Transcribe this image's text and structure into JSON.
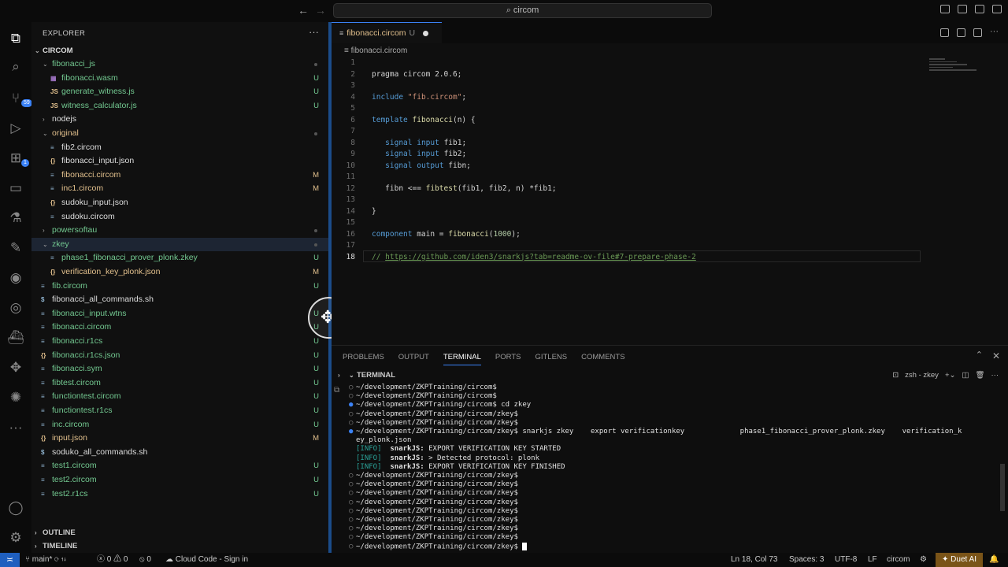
{
  "titlebar": {
    "search": "circom",
    "back_icon": "arrow-left-icon",
    "forward_icon": "arrow-right-icon"
  },
  "activitybar": {
    "source_control_badge": "59",
    "extensions_badge": "1"
  },
  "sidebar": {
    "title": "EXPLORER",
    "more": "···",
    "folder": "CIRCOM",
    "items": [
      {
        "name": "fibonacci_js",
        "kind": "folder",
        "open": true,
        "depth": 1,
        "color": "green",
        "status": "dot"
      },
      {
        "name": "fibonacci.wasm",
        "kind": "file",
        "icon": "▦",
        "depth": 2,
        "color": "green",
        "status": "U"
      },
      {
        "name": "generate_witness.js",
        "kind": "file",
        "icon": "JS",
        "depth": 2,
        "color": "green",
        "status": "U"
      },
      {
        "name": "witness_calculator.js",
        "kind": "file",
        "icon": "JS",
        "depth": 2,
        "color": "green",
        "status": "U"
      },
      {
        "name": "nodejs",
        "kind": "folder",
        "open": false,
        "depth": 1,
        "color": "white",
        "status": ""
      },
      {
        "name": "original",
        "kind": "folder",
        "open": true,
        "depth": 1,
        "color": "yellow",
        "status": "dot"
      },
      {
        "name": "fib2.circom",
        "kind": "file",
        "icon": "≡",
        "depth": 2,
        "color": "white",
        "status": ""
      },
      {
        "name": "fibonacci_input.json",
        "kind": "file",
        "icon": "{}",
        "depth": 2,
        "color": "white",
        "status": ""
      },
      {
        "name": "fibonacci.circom",
        "kind": "file",
        "icon": "≡",
        "depth": 2,
        "color": "yellow",
        "status": "M"
      },
      {
        "name": "inc1.circom",
        "kind": "file",
        "icon": "≡",
        "depth": 2,
        "color": "yellow",
        "status": "M"
      },
      {
        "name": "sudoku_input.json",
        "kind": "file",
        "icon": "{}",
        "depth": 2,
        "color": "white",
        "status": ""
      },
      {
        "name": "sudoku.circom",
        "kind": "file",
        "icon": "≡",
        "depth": 2,
        "color": "white",
        "status": ""
      },
      {
        "name": "powersoftau",
        "kind": "folder",
        "open": false,
        "depth": 1,
        "color": "green",
        "status": "dot"
      },
      {
        "name": "zkey",
        "kind": "folder",
        "open": true,
        "depth": 1,
        "color": "green",
        "status": "dot",
        "selected": true
      },
      {
        "name": "phase1_fibonacci_prover_plonk.zkey",
        "kind": "file",
        "icon": "≡",
        "depth": 2,
        "color": "green",
        "status": "U"
      },
      {
        "name": "verification_key_plonk.json",
        "kind": "file",
        "icon": "{}",
        "depth": 2,
        "color": "yellow",
        "status": "M"
      },
      {
        "name": "fib.circom",
        "kind": "file",
        "icon": "≡",
        "depth": 1,
        "color": "green",
        "status": "U"
      },
      {
        "name": "fibonacci_all_commands.sh",
        "kind": "file",
        "icon": "$",
        "depth": 1,
        "color": "white",
        "status": ""
      },
      {
        "name": "fibonacci_input.wtns",
        "kind": "file",
        "icon": "≡",
        "depth": 1,
        "color": "green",
        "status": "U"
      },
      {
        "name": "fibonacci.circom",
        "kind": "file",
        "icon": "≡",
        "depth": 1,
        "color": "green",
        "status": "U"
      },
      {
        "name": "fibonacci.r1cs",
        "kind": "file",
        "icon": "≡",
        "depth": 1,
        "color": "green",
        "status": "U"
      },
      {
        "name": "fibonacci.r1cs.json",
        "kind": "file",
        "icon": "{}",
        "depth": 1,
        "color": "green",
        "status": "U"
      },
      {
        "name": "fibonacci.sym",
        "kind": "file",
        "icon": "≡",
        "depth": 1,
        "color": "green",
        "status": "U"
      },
      {
        "name": "fibtest.circom",
        "kind": "file",
        "icon": "≡",
        "depth": 1,
        "color": "green",
        "status": "U"
      },
      {
        "name": "functiontest.circom",
        "kind": "file",
        "icon": "≡",
        "depth": 1,
        "color": "green",
        "status": "U"
      },
      {
        "name": "functiontest.r1cs",
        "kind": "file",
        "icon": "≡",
        "depth": 1,
        "color": "green",
        "status": "U"
      },
      {
        "name": "inc.circom",
        "kind": "file",
        "icon": "≡",
        "depth": 1,
        "color": "green",
        "status": "U"
      },
      {
        "name": "input.json",
        "kind": "file",
        "icon": "{}",
        "depth": 1,
        "color": "yellow",
        "status": "M"
      },
      {
        "name": "soduko_all_commands.sh",
        "kind": "file",
        "icon": "$",
        "depth": 1,
        "color": "white",
        "status": ""
      },
      {
        "name": "test1.circom",
        "kind": "file",
        "icon": "≡",
        "depth": 1,
        "color": "green",
        "status": "U"
      },
      {
        "name": "test2.circom",
        "kind": "file",
        "icon": "≡",
        "depth": 1,
        "color": "green",
        "status": "U"
      },
      {
        "name": "test2.r1cs",
        "kind": "file",
        "icon": "≡",
        "depth": 1,
        "color": "green",
        "status": "U"
      }
    ],
    "outline": "OUTLINE",
    "timeline": "TIMELINE"
  },
  "editor": {
    "tab_label": "fibonacci.circom",
    "tab_status": "U",
    "breadcrumb": "fibonacci.circom",
    "lines": [
      {
        "no": "1",
        "html": ""
      },
      {
        "no": "2",
        "html": "pragma circom 2.0.6;"
      },
      {
        "no": "3",
        "html": ""
      },
      {
        "no": "4",
        "html": "<span class='kw'>include</span> <span class='str'>\"fib.circom\"</span>;"
      },
      {
        "no": "5",
        "html": ""
      },
      {
        "no": "6",
        "html": "<span class='kw'>template</span> <span class='fn'>fibonacci</span>(n) {"
      },
      {
        "no": "7",
        "html": ""
      },
      {
        "no": "8",
        "html": "   <span class='kw'>signal</span> <span class='kw'>input</span> fib1;"
      },
      {
        "no": "9",
        "html": "   <span class='kw'>signal</span> <span class='kw'>input</span> fib2;"
      },
      {
        "no": "10",
        "html": "   <span class='kw'>signal</span> <span class='kw'>output</span> fibn;"
      },
      {
        "no": "11",
        "html": ""
      },
      {
        "no": "12",
        "html": "   fibn <== <span class='fn'>fibtest</span>(fib1, fib2, n) *fib1;"
      },
      {
        "no": "13",
        "html": ""
      },
      {
        "no": "14",
        "html": "}"
      },
      {
        "no": "15",
        "html": ""
      },
      {
        "no": "16",
        "html": "<span class='kw'>component</span> main = <span class='fn'>fibonacci</span>(<span class='num'>1000</span>);"
      },
      {
        "no": "17",
        "html": ""
      },
      {
        "no": "18",
        "html": "<span class='cm'>// </span><span class='url'>https://github.com/iden3/snarkjs?tab=readme-ov-file#7-prepare-phase-2</span>"
      }
    ],
    "current_line": "18"
  },
  "panel": {
    "tabs": [
      "PROBLEMS",
      "OUTPUT",
      "TERMINAL",
      "PORTS",
      "GITLENS",
      "COMMENTS"
    ],
    "active_tab": "TERMINAL",
    "terminal_title": "TERMINAL",
    "shell_label": "zsh - zkey",
    "terminal_lines": [
      {
        "b": "○",
        "t": "~/development/ZKPTraining/circom$"
      },
      {
        "b": "○",
        "t": "~/development/ZKPTraining/circom$"
      },
      {
        "b": "●",
        "t": "~/development/ZKPTraining/circom$ cd zkey"
      },
      {
        "b": "○",
        "t": "~/development/ZKPTraining/circom/zkey$"
      },
      {
        "b": "○",
        "t": "~/development/ZKPTraining/circom/zkey$"
      },
      {
        "b": "●",
        "t": "~/development/ZKPTraining/circom/zkey$ snarkjs zkey    export verificationkey             phase1_fibonacci_prover_plonk.zkey    verification_k"
      },
      {
        "b": "",
        "t": "ey_plonk.json"
      },
      {
        "b": "",
        "t": "[INFO]  snarkJS: EXPORT VERIFICATION KEY STARTED",
        "info": true
      },
      {
        "b": "",
        "t": "[INFO]  snarkJS: > Detected protocol: plonk",
        "info": true
      },
      {
        "b": "",
        "t": "[INFO]  snarkJS: EXPORT VERIFICATION KEY FINISHED",
        "info": true
      },
      {
        "b": "○",
        "t": "~/development/ZKPTraining/circom/zkey$"
      },
      {
        "b": "○",
        "t": "~/development/ZKPTraining/circom/zkey$"
      },
      {
        "b": "○",
        "t": "~/development/ZKPTraining/circom/zkey$"
      },
      {
        "b": "○",
        "t": "~/development/ZKPTraining/circom/zkey$"
      },
      {
        "b": "○",
        "t": "~/development/ZKPTraining/circom/zkey$"
      },
      {
        "b": "○",
        "t": "~/development/ZKPTraining/circom/zkey$"
      },
      {
        "b": "○",
        "t": "~/development/ZKPTraining/circom/zkey$"
      },
      {
        "b": "○",
        "t": "~/development/ZKPTraining/circom/zkey$"
      },
      {
        "b": "○",
        "t": "~/development/ZKPTraining/circom/zkey$",
        "cursor": true
      }
    ]
  },
  "statusbar": {
    "branch": "main*",
    "errors": "0",
    "warnings": "0",
    "ports": "0",
    "cloud": "Cloud Code - Sign in",
    "position": "Ln 18, Col 73",
    "spaces": "Spaces: 3",
    "encoding": "UTF-8",
    "eol": "LF",
    "language": "circom",
    "duet": "Duet AI"
  },
  "colors": {
    "accent": "#3b82f6",
    "untracked": "#73c991",
    "modified": "#e2c08d"
  }
}
